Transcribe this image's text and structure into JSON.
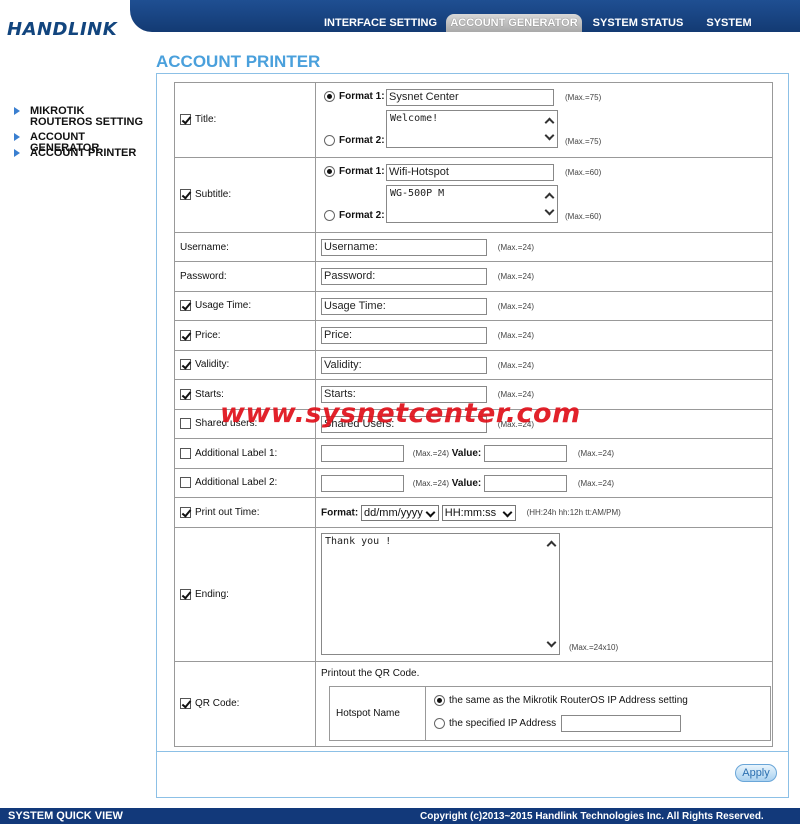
{
  "brand": {
    "logo": "HANDLINK"
  },
  "nav": {
    "tabs": [
      {
        "label": "INTERFACE SETTING",
        "active": false
      },
      {
        "label": "ACCOUNT GENERATOR",
        "active": true
      },
      {
        "label": "SYSTEM STATUS",
        "active": false
      },
      {
        "label": "SYSTEM TOOLS",
        "active": false
      }
    ]
  },
  "sidebar": {
    "items": [
      {
        "label": "MIKROTIK ROUTEROS SETTING"
      },
      {
        "label": "ACCOUNT GENERATOR"
      },
      {
        "label": "ACCOUNT PRINTER"
      }
    ]
  },
  "page": {
    "title": "ACCOUNT PRINTER"
  },
  "form": {
    "title": {
      "label": "Title:",
      "checked": true,
      "format1_label": "Format 1:",
      "format1_value": "Sysnet Center",
      "format1_max": "(Max.=75)",
      "format2_label": "Format 2:",
      "format2_value": "Welcome!",
      "format2_max": "(Max.=75)",
      "selected_format": 1
    },
    "subtitle": {
      "label": "Subtitle:",
      "checked": true,
      "format1_label": "Format 1:",
      "format1_value": "Wifi-Hotspot",
      "format1_max": "(Max.=60)",
      "format2_label": "Format 2:",
      "format2_value": "WG-500P M",
      "format2_max": "(Max.=60)",
      "selected_format": 1
    },
    "fields": [
      {
        "key": "username",
        "label": "Username:",
        "has_checkbox": false,
        "checked": false,
        "value": "Username:",
        "max": "(Max.=24)"
      },
      {
        "key": "password",
        "label": "Password:",
        "has_checkbox": false,
        "checked": false,
        "value": "Password:",
        "max": "(Max.=24)"
      },
      {
        "key": "usage_time",
        "label": "Usage Time:",
        "has_checkbox": true,
        "checked": true,
        "value": "Usage Time:",
        "max": "(Max.=24)"
      },
      {
        "key": "price",
        "label": "Price:",
        "has_checkbox": true,
        "checked": true,
        "value": "Price:",
        "max": "(Max.=24)"
      },
      {
        "key": "validity",
        "label": "Validity:",
        "has_checkbox": true,
        "checked": true,
        "value": "Validity:",
        "max": "(Max.=24)"
      },
      {
        "key": "starts",
        "label": "Starts:",
        "has_checkbox": true,
        "checked": true,
        "value": "Starts:",
        "max": "(Max.=24)"
      },
      {
        "key": "shared_users",
        "label": "Shared users:",
        "has_checkbox": true,
        "checked": false,
        "value": "Shared Users:",
        "max": "(Max.=24)"
      }
    ],
    "additional": [
      {
        "label": "Additional Label 1:",
        "checked": false,
        "value": "",
        "max": "(Max.=24)",
        "value_label": "Value:",
        "value2": "",
        "max2": "(Max.=24)"
      },
      {
        "label": "Additional Label 2:",
        "checked": false,
        "value": "",
        "max": "(Max.=24)",
        "value_label": "Value:",
        "value2": "",
        "max2": "(Max.=24)"
      }
    ],
    "print_time": {
      "label": "Print out Time:",
      "checked": true,
      "format_label": "Format:",
      "date_format": "dd/mm/yyyy",
      "time_format": "HH:mm:ss",
      "hint": "(HH:24h hh:12h tt:AM/PM)"
    },
    "ending": {
      "label": "Ending:",
      "checked": true,
      "value": "Thank you !",
      "max": "(Max.=24x10)"
    },
    "qr": {
      "label": "QR Code:",
      "checked": true,
      "intro": "Printout the QR Code.",
      "hotspot_label": "Hotspot Name",
      "option1": "the same as the Mikrotik RouterOS IP Address setting",
      "option2": "the specified IP Address",
      "selected_option": 1,
      "ip_value": ""
    }
  },
  "apply_label": "Apply",
  "watermark": "www.sysnetcenter.com",
  "footer": {
    "left": "SYSTEM QUICK VIEW",
    "right": "Copyright (c)2013~2015 Handlink Technologies Inc. All Rights Reserved."
  }
}
